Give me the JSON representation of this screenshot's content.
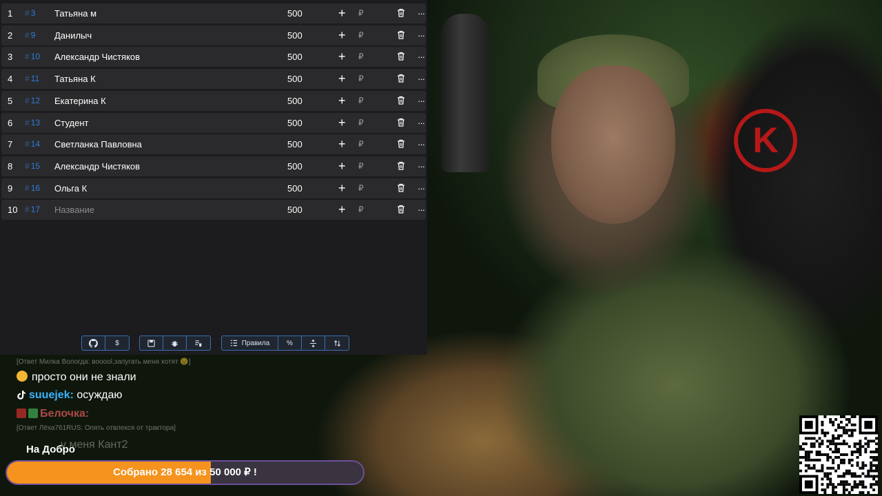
{
  "table": {
    "rows": [
      {
        "idx": "1",
        "num": "3",
        "name": "Татьяна м",
        "amount": "500",
        "plus": "+",
        "currency": "₽"
      },
      {
        "idx": "2",
        "num": "9",
        "name": "Данилыч",
        "amount": "500",
        "plus": "+",
        "currency": "₽"
      },
      {
        "idx": "3",
        "num": "10",
        "name": "Александр Чистяков",
        "amount": "500",
        "plus": "+",
        "currency": "₽"
      },
      {
        "idx": "4",
        "num": "11",
        "name": "Татьяна К",
        "amount": "500",
        "plus": "+",
        "currency": "₽"
      },
      {
        "idx": "5",
        "num": "12",
        "name": "Екатерина К",
        "amount": "500",
        "plus": "+",
        "currency": "₽"
      },
      {
        "idx": "6",
        "num": "13",
        "name": "Студент",
        "amount": "500",
        "plus": "+",
        "currency": "₽"
      },
      {
        "idx": "7",
        "num": "14",
        "name": "Светланка Павловна",
        "amount": "500",
        "plus": "+",
        "currency": "₽"
      },
      {
        "idx": "8",
        "num": "15",
        "name": "Александр Чистяков",
        "amount": "500",
        "plus": "+",
        "currency": "₽"
      },
      {
        "idx": "9",
        "num": "16",
        "name": "Ольга К",
        "amount": "500",
        "plus": "+",
        "currency": "₽"
      },
      {
        "idx": "10",
        "num": "17",
        "name": "Название",
        "amount": "500",
        "plus": "+",
        "currency": "₽"
      }
    ],
    "hash_symbol": "#",
    "more_symbol": "···"
  },
  "toolbar": {
    "github_icon": "github-icon",
    "dollar_label": "$",
    "rules_label": "Правила",
    "percent_label": "%"
  },
  "chat": {
    "faded_top": "[Ответ Милка Вологда: вооооl,запугать меня хотят 😟]",
    "line1": "просто они не знали",
    "line2_user": "suuejek:",
    "line2_text": "осуждаю",
    "line3_user": "Белочка:",
    "faded_mid": "[Ответ Лёха761RUS: Опять отвлекся от трактора]",
    "line4": "у меня Кант2",
    "line5": "На Добро"
  },
  "donation": {
    "text": "Собрано 28 654  из 50 000 ₽ !",
    "fraction": 0.5731
  },
  "colors": {
    "accent_blue": "#2f7bd9",
    "progress_orange": "#f6931e",
    "progress_border": "#6c4f9b",
    "chat_user": "#3bb4ff"
  }
}
